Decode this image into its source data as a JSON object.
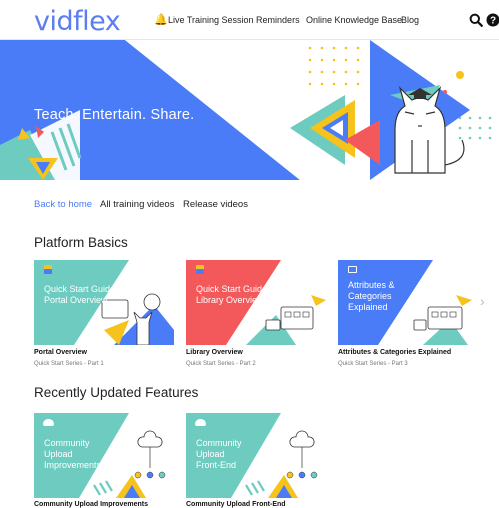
{
  "header": {
    "logo_text": "vidflex",
    "nav": [
      {
        "label": "Live Training Session Reminders"
      },
      {
        "label": "Online Knowledge Base"
      },
      {
        "label": "Blog"
      }
    ],
    "search_icon": "search-icon",
    "help_icon": "help-icon"
  },
  "banner": {
    "tagline": "Teach. Entertain. Share."
  },
  "tabs": [
    {
      "label": "Back to home"
    },
    {
      "label": "All training videos"
    },
    {
      "label": "Release videos"
    }
  ],
  "sections": [
    {
      "title": "Platform Basics",
      "cards": [
        {
          "thumb_text": "Quick Start Guide -\nPortal Overview",
          "title": "Portal Overview",
          "subtitle": "Quick Start Series - Part 1",
          "color": "#6ecbc0"
        },
        {
          "thumb_text": "Quick Start Guide -\nLibrary Overview",
          "title": "Library Overview",
          "subtitle": "Quick Start Series - Part 2",
          "color": "#f3585a"
        },
        {
          "thumb_text": "Attributes &\nCategories\nExplained",
          "title": "Attributes & Categories Explained",
          "subtitle": "Quick Start Series - Part 3",
          "color": "#4a7cf7"
        }
      ]
    },
    {
      "title": "Recently Updated Features",
      "cards": [
        {
          "thumb_text": "Community\nUpload\nImprovements",
          "title": "Community Upload Improvements",
          "color": "#6ecbc0"
        },
        {
          "thumb_text": "Community\nUpload\nFront-End",
          "title": "Community Upload Front-End",
          "color": "#6ecbc0"
        }
      ]
    }
  ],
  "colors": {
    "brand_blue": "#4a7cf7",
    "teal": "#6ecbc0",
    "coral": "#f3585a",
    "yellow": "#f6c21c"
  }
}
